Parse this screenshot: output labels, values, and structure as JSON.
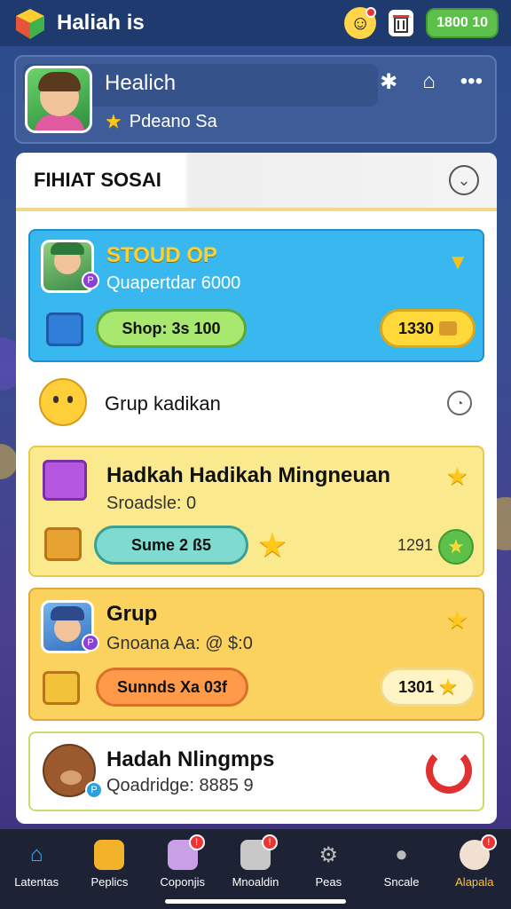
{
  "header": {
    "app_title": "Haliah is",
    "coins": "1800 10",
    "icons": [
      "cube-logo-icon",
      "emoji-notification-icon",
      "trash-icon"
    ]
  },
  "profile": {
    "name": "Healich",
    "subtitle": "Pdeano Sa",
    "icons": [
      "puzzle-icon",
      "house-icon",
      "more-icon"
    ]
  },
  "panel": {
    "title": "FIHIAT SOSAI"
  },
  "cards": [
    {
      "title": "STOUD OP",
      "subtitle": "Quapertdar 6000",
      "button": "Shop: 3s 100",
      "value": "1330",
      "color": "#39b8ef"
    },
    {
      "title": "Grup kadikan"
    },
    {
      "title": "Hadkah Hadikah Mingneuan",
      "subtitle": "Sroadsle: 0",
      "button": "Sume 2 ß5",
      "value": "1291",
      "color": "#fbe98e"
    },
    {
      "title": "Grup",
      "subtitle": "Gnoana Aa: @ $:0",
      "button": "Sunnds Xa 03f",
      "value": "1301",
      "color": "#fcd25e"
    },
    {
      "title": "Hadah Nlingmps",
      "subtitle": "Qoadridge: 8885 9"
    }
  ],
  "nav": [
    {
      "label": "Latentas",
      "icon": "home-icon"
    },
    {
      "label": "Peplics",
      "icon": "puzzle-box-icon"
    },
    {
      "label": "Coponjis",
      "icon": "gift-box-icon",
      "badge": "!"
    },
    {
      "label": "Mnoaldin",
      "icon": "stack-box-icon",
      "badge": "!"
    },
    {
      "label": "Peas",
      "icon": "gear-icon"
    },
    {
      "label": "Sncale",
      "icon": "person-icon"
    },
    {
      "label": "Alapala",
      "icon": "character-icon",
      "badge": "!"
    }
  ]
}
